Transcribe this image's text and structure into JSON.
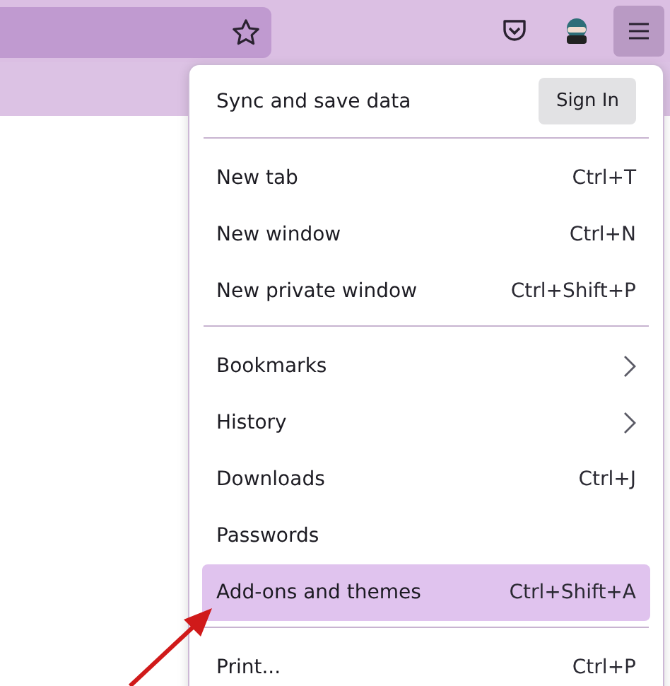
{
  "menu": {
    "header": {
      "label": "Sync and save data",
      "button": "Sign In"
    },
    "groups": [
      [
        {
          "label": "New tab",
          "shortcut": "Ctrl+T",
          "submenu": false,
          "selected": false
        },
        {
          "label": "New window",
          "shortcut": "Ctrl+N",
          "submenu": false,
          "selected": false
        },
        {
          "label": "New private window",
          "shortcut": "Ctrl+Shift+P",
          "submenu": false,
          "selected": false
        }
      ],
      [
        {
          "label": "Bookmarks",
          "submenu": true,
          "selected": false
        },
        {
          "label": "History",
          "submenu": true,
          "selected": false
        },
        {
          "label": "Downloads",
          "shortcut": "Ctrl+J",
          "submenu": false,
          "selected": false
        },
        {
          "label": "Passwords",
          "submenu": false,
          "selected": false
        },
        {
          "label": "Add-ons and themes",
          "shortcut": "Ctrl+Shift+A",
          "submenu": false,
          "selected": true
        }
      ],
      [
        {
          "label": "Print...",
          "shortcut": "Ctrl+P",
          "submenu": false,
          "selected": false
        }
      ]
    ]
  }
}
